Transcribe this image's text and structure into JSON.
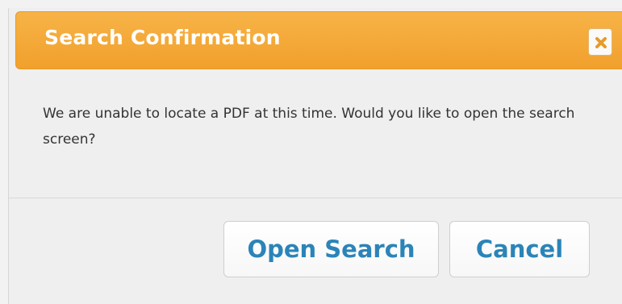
{
  "dialog": {
    "title": "Search Confirmation",
    "close_icon": "close-x-icon",
    "message": "We are unable to locate a PDF at this time. Would you like to open the search screen?",
    "buttons": {
      "open_search": "Open Search",
      "cancel": "Cancel"
    }
  },
  "colors": {
    "header": "#f4a93a",
    "button_text": "#2b84b8",
    "close_icon": "#e89a2a",
    "background": "#efefef"
  }
}
